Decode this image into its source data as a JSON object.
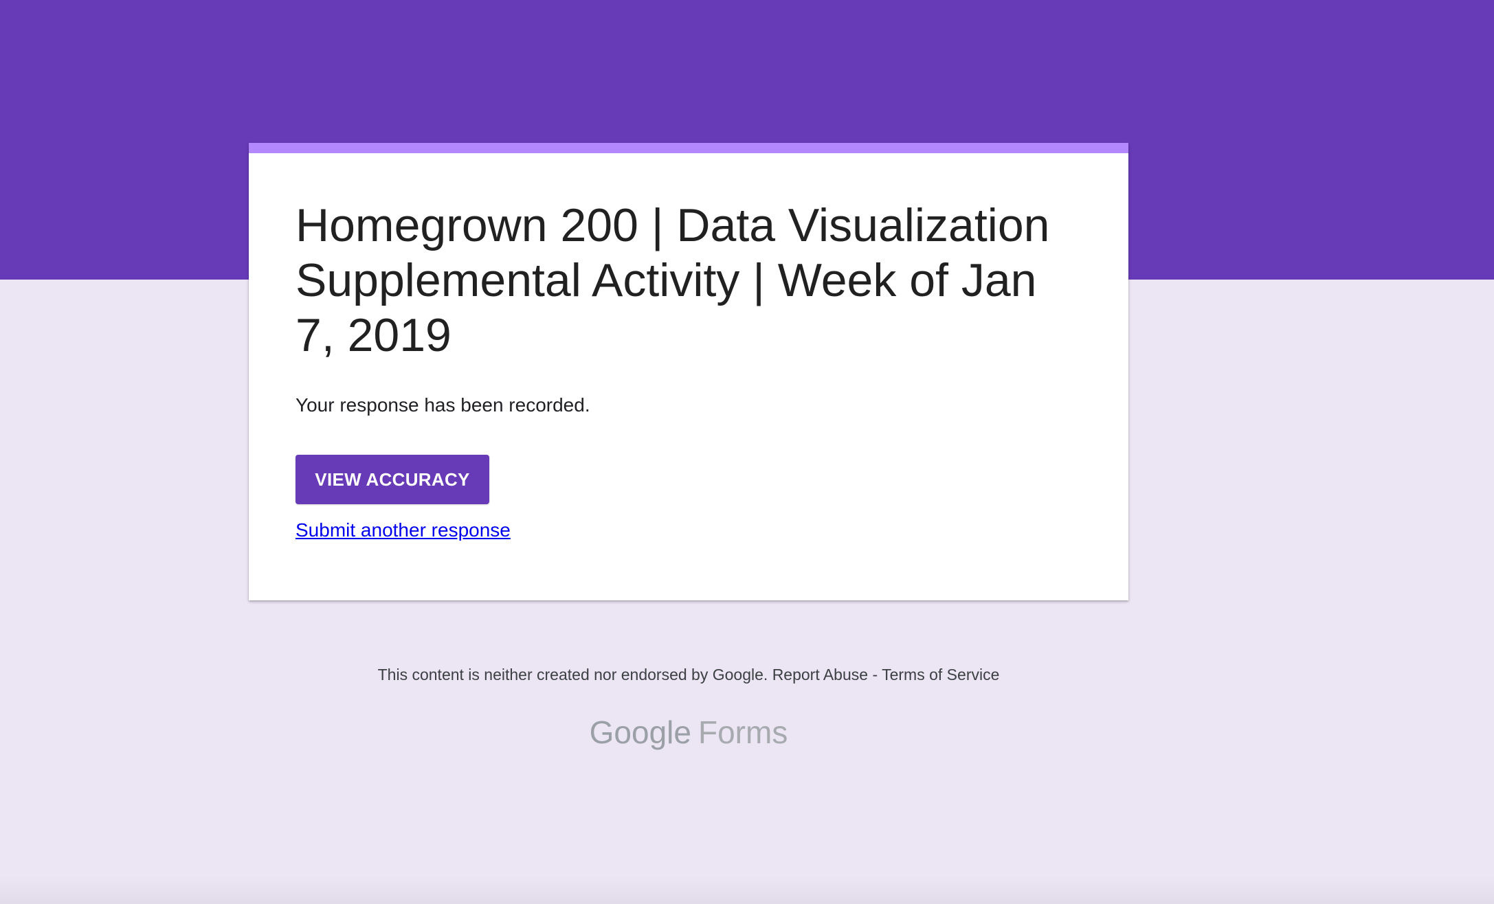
{
  "theme": {
    "header_color": "#673ab7",
    "accent_color": "#b388ff",
    "background_color": "#ebe5f4",
    "button_color": "#673ab7",
    "link_color": "#0000ee"
  },
  "form": {
    "title": "Homegrown 200 | Data Visualization Supplemental Activity | Week of Jan 7, 2019",
    "confirmation_message": "Your response has been recorded.",
    "view_accuracy_label": "VIEW ACCURACY",
    "submit_another_label": "Submit another response"
  },
  "footer": {
    "disclaimer": "This content is neither created nor endorsed by Google.",
    "report_abuse": "Report Abuse",
    "separator": "-",
    "terms": "Terms of Service"
  },
  "branding": {
    "google": "Google",
    "forms": "Forms"
  }
}
